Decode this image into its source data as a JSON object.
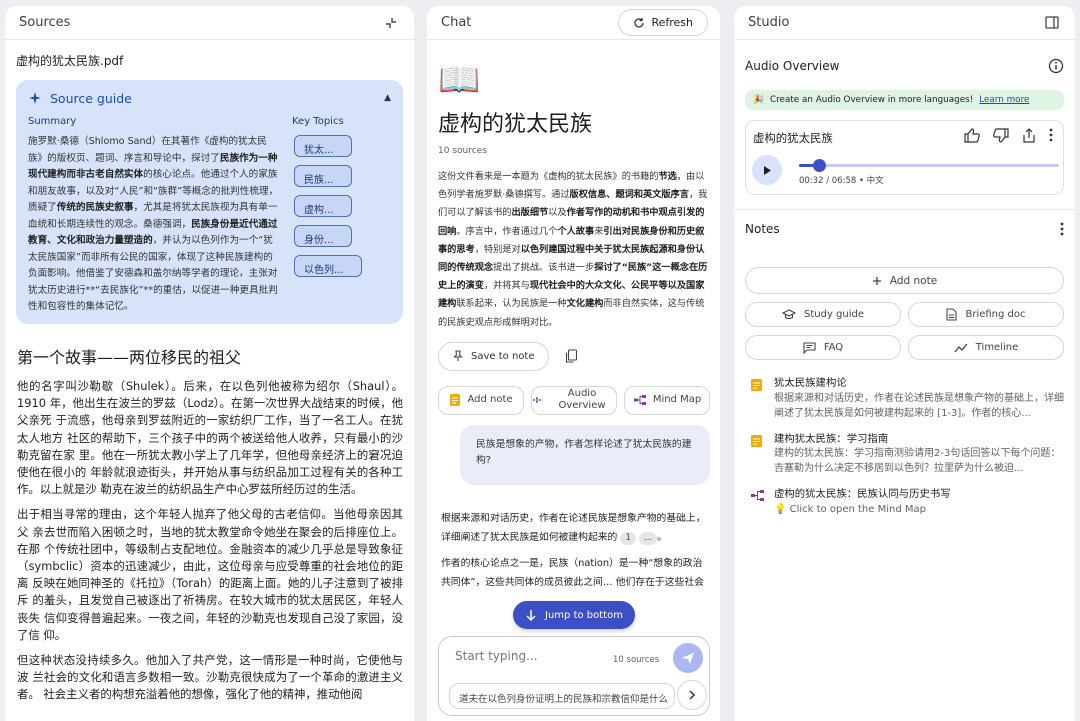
{
  "sources": {
    "header": "Sources",
    "file_title": "虚构的犹太民族.pdf",
    "guide_title": "Source guide",
    "summary_label": "Summary",
    "topics_label": "Key Topics",
    "summary_text": "施罗默·桑德（Shlomo Sand）在其著作《虚构的犹太民族》的版权页、题词、序言和导论中，探讨了",
    "summary_bold1": "民族作为一种现代建构而非古老自然实体",
    "summary_text2": "的核心论点。他通过个人的家族和朋友故事，以及对“人民”和“族群”等概念的批判性梳理，质疑了",
    "summary_bold2": "传统的民族史叙事",
    "summary_text3": "，尤其是将犹太民族视为具有单一血统和长期连续性的观念。桑德强调，",
    "summary_bold3": "民族身份是近代通过教育、文化和政治力量塑造的",
    "summary_text4": "，并认为以色列作为一个“犹太民族国家”而非所有公民的国家，体现了这种民族建构的负面影响。他借鉴了安德森和盖尔纳等学者的理论，主张对犹太历史进行**“去民族化”**的重估，以促进一种更具批判性和包容性的集体记忆。",
    "topics": [
      "犹太...",
      "民族...",
      "虚构...",
      "身份...",
      "以色列..."
    ],
    "article_heading": "第一个故事——两位移民的祖父",
    "paragraphs": [
      "他的名字叫沙勒歇（Shulek）。后来，在以色列他被称为绍尔（Shaul）。1910 年，他出生在波兰的罗兹（Lodz）。在第一次世界大战结束的时候，他父亲死 于流感，他母亲到罗兹附近的一家纺织厂工作，当了一名工人。在犹太人地方 社区的帮助下，三个孩子中的两个被送给他人收养，只有最小的沙勒克留在家 里。他在一所犹太教小学上了几年学，但他母亲经济上的窘况迫使他在很小的 年龄就浪迹街头，并开始从事与纺织品加工过程有关的各种工作。以上就是沙 勒克在波兰的纺织品生产中心罗兹所经历过的生活。",
      "出于相当寻常的理由，这个年轻人抛弃了他父母的古老信仰。当他母亲因其父 亲去世而陷入困顿之时，当地的犹太教堂命令她坐在聚会的后排座位上。在那 个传统社团中，等级制占支配地位。金融资本的减少几乎总是导致象征 （symbclic）资本的迅速减少，由此，这位母亲与应受尊重的社会地位的距离 反映在她同神圣的《托拉》（Torah）的距离上面。她的儿子注意到了被排斥 的羞头，且发觉自己被逐出了祈祷房。在较大城市的犹太居民区，年轻人丧失 信仰变得普遍起来。一夜之间，年轻的沙勒克也发现自己没了家园，没了信 仰。",
      "但这种状态没持续多久。他加入了共产党，这一情形是一种时尚，它使他与波 兰社会的文化和语言多数相一致。沙勒克很快成为了一个革命的激进主义者。 社会主义者的构想充溢着他的想像，强化了他的精神，推动他阅"
    ]
  },
  "chat": {
    "header": "Chat",
    "refresh_label": "Refresh",
    "book_emoji": "📖",
    "title": "虚构的犹太民族",
    "source_count": "10 sources",
    "summary_html": "这份文件看来是一本题为《虚构的犹太民族》的书籍的<b>节选</b>，由以色列学者施罗默·桑德撰写。通过<b>版权信息、题词和英文版序言</b>，我们可以了解该书的<b>出版细节</b>以及<b>作者写作的动机和书中观点引发的回响</b>。序言中，作者通过几个<b>个人故事</b>来<b>引出对民族身份和历史叙事的思考</b>，特别是对<b>以色列建国过程中关于犹太民族起源和身份认同的传统观念</b>提出了挑战。该书进一步<b>探讨了“民族”这一概念在历史上的演变</b>，并将其与<b>现代社会中的大众文化、公民平等以及国家建构</b>联系起来，认为民族是一种<b>文化建构</b>而非自然实体，这与传统的民族史观点形成鲜明对比。",
    "save_note_label": "Save to note",
    "actions": [
      {
        "label": "Add note"
      },
      {
        "label": "Audio Overview"
      },
      {
        "label": "Mind Map"
      }
    ],
    "user_message": "民族是想象的产物，作者怎样论述了犹太民族的建构?",
    "bot_line1": "根据来源和对话历史，作者在论述民族是想象产物的基础上，详细阐述了犹太民族是如何被建构起来的",
    "cite1": "1",
    "cite2": "...",
    "bot_line2": "作者的核心论点之一是，民族（nation）是一种“想象的政治共同体”，这些共同体的成员彼此之间… 他们存在于这些社会",
    "jump_label": "Jump to bottom",
    "composer_placeholder": "Start typing...",
    "composer_count": "10 sources",
    "suggestion": "道夫在以色列身份证明上的民族和宗教信仰是什么"
  },
  "studio": {
    "header": "Studio",
    "audio_label": "Audio Overview",
    "banner_emoji": "🎉",
    "banner_text": "Create an Audio Overview in more languages!",
    "banner_link": "Learn more",
    "audio_title": "虚构的犹太民族",
    "audio_time": "00:32 / 06:58 • 中文",
    "audio_progress_fraction": 0.077,
    "notes_label": "Notes",
    "add_note_label": "Add note",
    "note_buttons": [
      {
        "label": "Study guide"
      },
      {
        "label": "Briefing doc"
      },
      {
        "label": "FAQ"
      },
      {
        "label": "Timeline"
      }
    ],
    "notes": [
      {
        "title": "犹太民族建构论",
        "desc": "根据来源和对话历史，作者在论述民族是想象产物的基础上，详细阐述了犹太民族是如何被建构起来的 [1-3]。作者的核心..."
      },
      {
        "title": "建构犹太民族：学习指南",
        "desc": "建构的犹太民族：学习指南测验请用2-3句话回答以下每个问题：吉塞勒为什么决定不移居到以色列？拉里萨为什么被迫..."
      },
      {
        "title": "虚构的犹太民族：民族认同与历史书写",
        "desc": "💡 Click to open the Mind Map"
      }
    ],
    "colors": {
      "accent": "#3b50c6",
      "note_icon": "#f2a900",
      "mindmap_icon": "#7b3fa0"
    }
  }
}
